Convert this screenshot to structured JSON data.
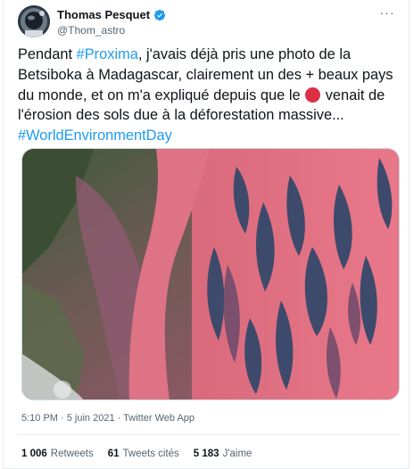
{
  "tweet": {
    "author": {
      "display_name": "Thomas Pesquet",
      "handle": "@Thom_astro",
      "verified": true,
      "avatar_icon": "astronaut-avatar"
    },
    "more_label": "···",
    "text": {
      "part1": "Pendant ",
      "hashtag1": "#Proxima",
      "part2": ", j'avais déjà pris une photo de la Betsiboka à Madagascar, clairement un des + beaux pays du monde, et on m'a expliqué depuis que le ",
      "emoji": "red-circle",
      "part3": " venait de l'érosion des sols due à la déforestation massive... ",
      "hashtag2": "#WorldEnvironmentDay"
    },
    "image_description_icon": "satellite-photo-betsiboka-delta",
    "timestamp": {
      "time": "5:10 PM",
      "separator": " · ",
      "date": "5 juin 2021",
      "separator2": " · ",
      "source": "Twitter Web App"
    },
    "stats": {
      "retweets_count": "1 006",
      "retweets_label": "Retweets",
      "quotes_count": "61",
      "quotes_label": "Tweets cités",
      "likes_count": "5 183",
      "likes_label": "J'aime"
    }
  },
  "colors": {
    "accent": "#1d9bf0",
    "text": "#0f1419",
    "secondary": "#536471",
    "border": "#e6ecf0",
    "emoji_red": "#dd2e44"
  }
}
